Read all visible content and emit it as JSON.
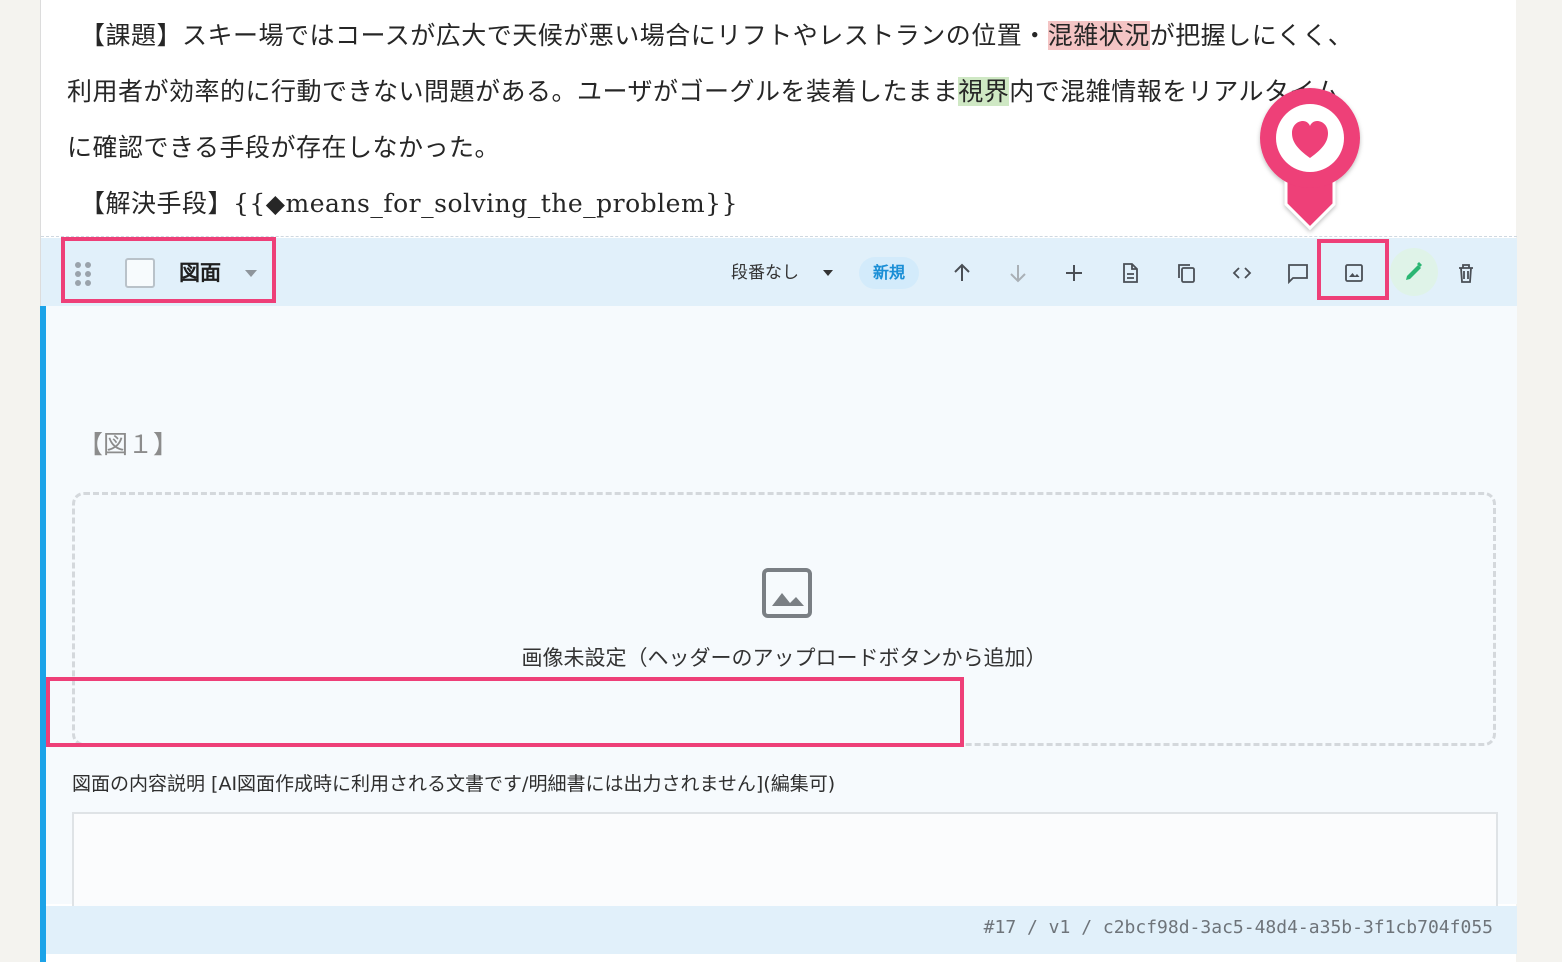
{
  "document": {
    "line1_a": "　【課題】スキー場ではコースが広大で天候が悪い場合にリフトやレストランの位置・",
    "line1_hl": "混雑状況",
    "line1_b": "が把握しにくく、",
    "line2_a": "利用者が効率的に行動できない問題がある。ユーザがゴーグルを装着したまま",
    "line2_hl": "視界",
    "line2_b": "内で混雑情報をリアルタイム",
    "line3": "に確認できる手段が存在しなかった。",
    "line4": "　【解決手段】{{◆means_for_solving_the_problem}}"
  },
  "toolbar": {
    "block_type": "図面",
    "numbering": "段番なし",
    "status_badge": "新規",
    "icons": [
      "drag-handle-icon",
      "checkbox",
      "move-up-icon",
      "move-down-icon",
      "add-icon",
      "document-icon",
      "copy-icon",
      "code-icon",
      "comment-icon",
      "image-upload-icon",
      "edit-icon",
      "delete-icon"
    ]
  },
  "figure": {
    "label": "【図１】",
    "placeholder": "画像未設定（ヘッダーのアップロードボタンから追加）",
    "description_label": "図面の内容説明 [AI図面作成時に利用される文書です/明細書には出力されません](編集可)",
    "description_value": ""
  },
  "footer": {
    "block_id": "#17 / v1 / c2bcf98d-3ac5-48d4-a35b-3f1cb704f055"
  },
  "colors": {
    "accent_blue": "#1ca3e8",
    "highlight_pink": "#ee3f78",
    "toolbar_bg": "#e1f0fa",
    "edit_green": "#2bb673"
  }
}
